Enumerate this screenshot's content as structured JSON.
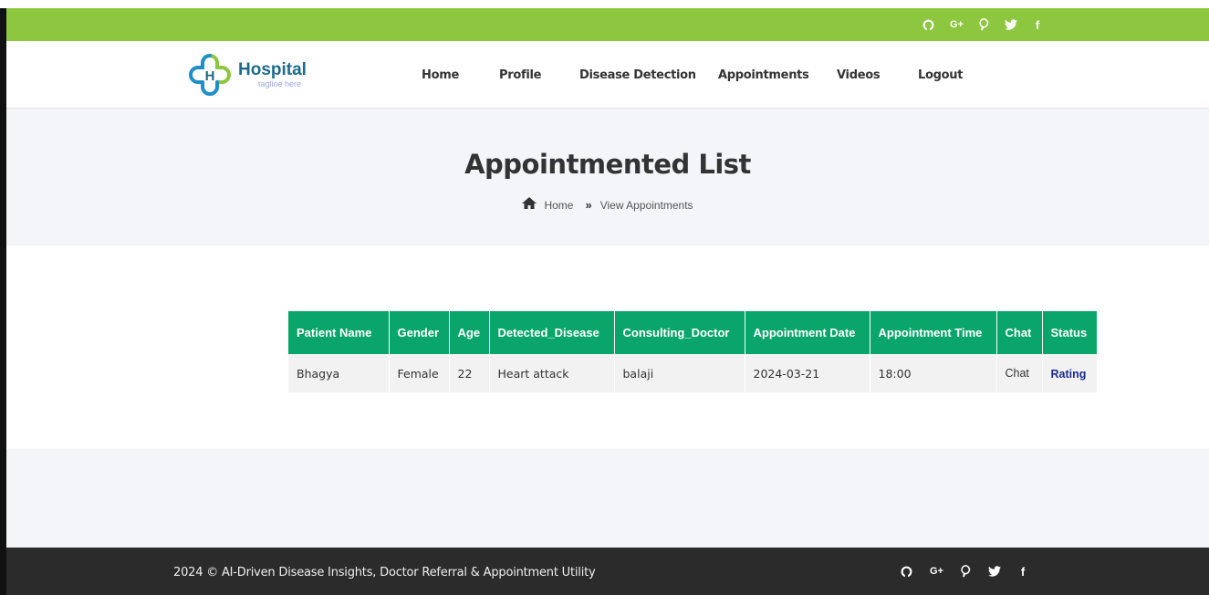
{
  "social_icons": [
    {
      "name": "github-icon",
      "glyph": "❁"
    },
    {
      "name": "google-plus-icon",
      "glyph": "G+"
    },
    {
      "name": "pinterest-icon",
      "glyph": "℗"
    },
    {
      "name": "twitter-icon",
      "glyph": "✈"
    },
    {
      "name": "facebook-icon",
      "glyph": "f"
    }
  ],
  "brand": {
    "name": "Hospital",
    "tagline": "tagline here"
  },
  "nav": {
    "home": "Home",
    "profile": "Profile",
    "disease_detection": "Disease Detection",
    "appointments": "Appointments",
    "videos": "Videos",
    "logout": "Logout"
  },
  "hero": {
    "title": "Appointmented List",
    "breadcrumb_home": "Home",
    "breadcrumb_current": "View Appointments"
  },
  "table": {
    "headers": [
      "Patient Name",
      "Gender",
      "Age",
      "Detected_Disease",
      "Consulting_Doctor",
      "Appointment Date",
      "Appointment Time",
      "Chat",
      "Status"
    ],
    "rows": [
      {
        "patient_name": "Bhagya",
        "gender": "Female",
        "age": "22",
        "detected_disease": "Heart attack",
        "consulting_doctor": "balaji",
        "appointment_date": "2024-03-21",
        "appointment_time": "18:00",
        "chat": "Chat",
        "status": "Rating"
      }
    ]
  },
  "footer": {
    "copyright": "2024 © AI-Driven Disease Insights, Doctor Referral & Appointment Utility"
  },
  "colors": {
    "topbar": "#8dc63f",
    "table_header": "#0aa56b",
    "footer": "#2b2b2b",
    "brand_text": "#1e6b8c",
    "rating_link": "#1a2a8c"
  }
}
